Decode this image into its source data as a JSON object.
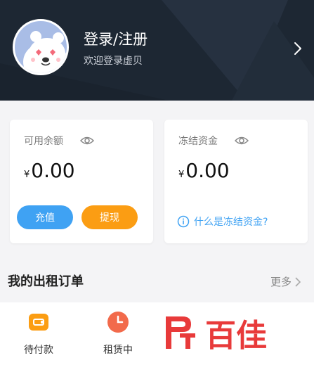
{
  "header": {
    "title": "登录/注册",
    "subtitle": "欢迎登录虚贝"
  },
  "balance_card": {
    "label": "可用余额",
    "currency": "¥",
    "amount": "0.00",
    "recharge_label": "充值",
    "withdraw_label": "提现"
  },
  "frozen_card": {
    "label": "冻结资金",
    "currency": "¥",
    "amount": "0.00",
    "info_link": "什么是冻结资金?"
  },
  "orders_section": {
    "title": "我的出租订单",
    "more_label": "更多",
    "items": [
      {
        "label": "待付款",
        "icon": "wallet-icon"
      },
      {
        "label": "租赁中",
        "icon": "clock-icon"
      }
    ]
  },
  "watermark": "百佳",
  "colors": {
    "header_bg": "#1d2733",
    "accent_blue": "#3fa2f3",
    "accent_orange": "#fb9d13",
    "watermark_red": "#e83a3a"
  }
}
